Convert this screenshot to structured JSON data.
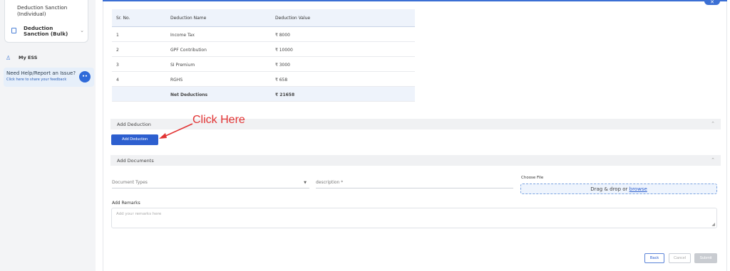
{
  "sidebar": {
    "items": [
      {
        "label": "Deduction Sanction (Individual)"
      },
      {
        "label": "Deduction Sanction (Bulk)"
      }
    ],
    "my_ess": "My ESS",
    "help": {
      "title": "Need Help/Report an Issue?",
      "subtitle": "Click here to share your feedback"
    }
  },
  "table": {
    "headers": [
      "Sr. No.",
      "Deduction Name",
      "Deduction Value"
    ],
    "rows": [
      {
        "sr": "1",
        "name": "Income Tax",
        "value": "₹ 8000"
      },
      {
        "sr": "2",
        "name": "GPF Contribution",
        "value": "₹ 10000"
      },
      {
        "sr": "3",
        "name": "SI Premium",
        "value": "₹ 3000"
      },
      {
        "sr": "4",
        "name": "RGHS",
        "value": "₹ 658"
      }
    ],
    "total_label": "Net Deductions",
    "total_value": "₹ 21658"
  },
  "add_deduction": {
    "section_label": "Add Deduction",
    "button_label": "Add Deduction",
    "annotation": "Click Here"
  },
  "documents": {
    "section_label": "Add Documents",
    "type_placeholder": "Document Types",
    "description_placeholder": "description *",
    "choose_file_label": "Choose File",
    "drop_text": "Drag & drop or ",
    "browse_text": "browse",
    "remarks_label": "Add Remarks",
    "remarks_placeholder": "Add your remarks here"
  },
  "footer": {
    "back": "Back",
    "cancel": "Cancel",
    "submit": "Submit"
  },
  "colors": {
    "primary": "#2d5fcf",
    "annotation": "#e23333"
  }
}
